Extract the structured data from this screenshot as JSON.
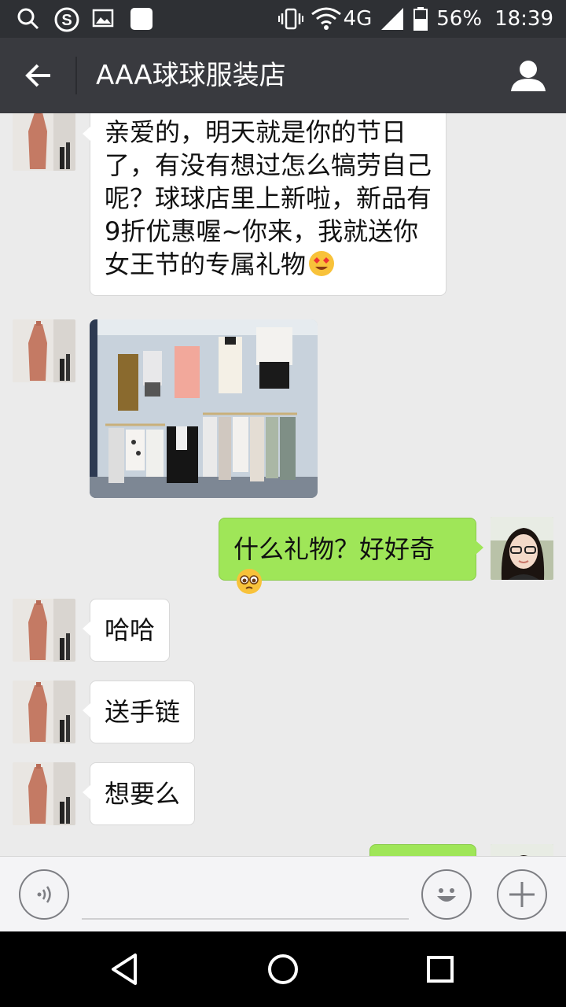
{
  "status_bar": {
    "network": "4G",
    "battery": "56%",
    "time": "18:39",
    "icons": [
      "search-icon",
      "sogou-icon",
      "gallery-icon",
      "app-icon",
      "vibrate-icon",
      "wifi-icon",
      "signal-icon",
      "battery-icon"
    ]
  },
  "header": {
    "title": "AAA球球服装店",
    "back_icon": "arrow-left-icon",
    "profile_icon": "person-icon"
  },
  "messages": [
    {
      "side": "left",
      "type": "text",
      "text": "亲爱的，明天就是你的节日了，有没有想过怎么犒劳自己呢？球球店里上新啦，新品有9折优惠喔~你来，我就送你女王节的专属礼物",
      "emoji": "heart-eyes-emoji"
    },
    {
      "side": "left",
      "type": "image",
      "description": "clothing-rack-photo"
    },
    {
      "side": "right",
      "type": "text",
      "text": "什么礼物？好好奇",
      "emoji": "pleading-emoji"
    },
    {
      "side": "left",
      "type": "text",
      "text": "哈哈"
    },
    {
      "side": "left",
      "type": "text",
      "text": "送手链"
    },
    {
      "side": "left",
      "type": "text",
      "text": "想要么"
    },
    {
      "side": "right",
      "type": "text",
      "text": ""
    }
  ],
  "input_bar": {
    "voice_icon": "voice-icon",
    "emoji_icon": "smiley-icon",
    "more_icon": "plus-icon"
  },
  "nav_bar": {
    "icons": [
      "back-triangle-icon",
      "home-circle-icon",
      "recents-square-icon"
    ]
  },
  "colors": {
    "status_bar": "#2e3034",
    "title_bar": "#393a3f",
    "chat_bg": "#ebebeb",
    "outgoing_bubble": "#9fe658",
    "incoming_bubble": "#ffffff"
  }
}
